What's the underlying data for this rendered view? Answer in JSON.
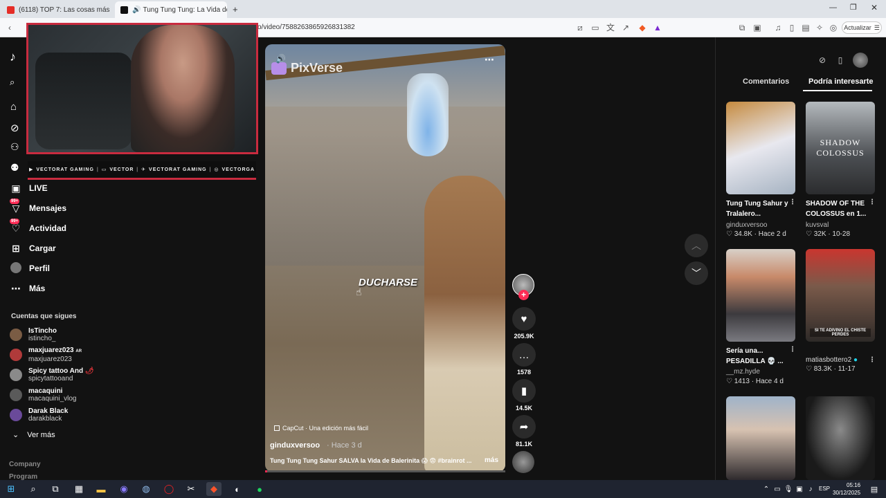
{
  "browser": {
    "tabs": [
      {
        "label": "(6118) TOP 7: Las cosas más PERTUR",
        "icon": "youtube-icon",
        "active": false
      },
      {
        "label": "Tung Tung Tung: La Vida de",
        "icon": "tiktok-icon",
        "active": true
      }
    ],
    "url": "o/video/7588263865926831382",
    "update_label": "Actualizar"
  },
  "sidebar": {
    "nav": [
      {
        "label": "LIVE",
        "icon": "live-icon"
      },
      {
        "label": "Mensajes",
        "icon": "messages-icon",
        "badge": "99+"
      },
      {
        "label": "Actividad",
        "icon": "activity-icon",
        "badge": "99+"
      },
      {
        "label": "Cargar",
        "icon": "upload-icon"
      },
      {
        "label": "Perfil",
        "icon": "profile-icon"
      },
      {
        "label": "Más",
        "icon": "more-icon"
      }
    ],
    "following_title": "Cuentas que sigues",
    "following": [
      {
        "name": "IsTincho",
        "handle": "istincho_",
        "color": "#7a5c44"
      },
      {
        "name": "maxjuarez023",
        "suffix": "AR",
        "handle": "maxjuarez023",
        "color": "#b03a3a"
      },
      {
        "name": "Spicy tattoo And",
        "handle": "spicytattooand",
        "color": "#8a8a8a"
      },
      {
        "name": "macaquini",
        "handle": "macaquini_vlog",
        "color": "#5a5a5a"
      },
      {
        "name": "Darak Black",
        "handle": "darakblack",
        "color": "#6a4a9a"
      }
    ],
    "see_more": "Ver más",
    "footer": [
      "Company",
      "Program"
    ]
  },
  "stream_overlay": {
    "socials": [
      {
        "label": "VECTORAT GAMING",
        "icon": "youtube-icon"
      },
      {
        "label": "VECTOR",
        "icon": "twitch-icon"
      },
      {
        "label": "VECTORAT GAMING",
        "icon": "twitter-icon"
      },
      {
        "label": "VECTORGA",
        "icon": "instagram-icon"
      }
    ]
  },
  "video": {
    "watermark": "PixVerse",
    "overlay_text": "DUCHARSE",
    "capcut": "CapCut · Una edición más fácil",
    "author": "ginduxversoo",
    "date": "· Hace 3 d",
    "description": "Tung Tung Tung Sahur SALVA la Vida de Balerinita 😱 😨 #brainrot ...",
    "more": "más",
    "progress": 0.01
  },
  "actions": {
    "likes": "205.9K",
    "comments": "1578",
    "saves": "14.5K",
    "shares": "81.1K"
  },
  "right_panel": {
    "tabs": [
      "Comentarios",
      "Podría interesarte"
    ],
    "cards": [
      {
        "title": "Tung Tung Sahur y Tralalero...",
        "author": "ginduxversoo",
        "stats": "♡ 34.8K · Hace 2 d"
      },
      {
        "title": "SHADOW OF THE COLOSSUS en 1...",
        "author": "kuvsval",
        "stats": "♡ 32K · 10-28",
        "thumb_text": "SHADOW COLOSSUS"
      },
      {
        "title": "Sería una... PESADILLA 💀 ...",
        "author": "__mz.hyde",
        "stats": "♡ 1413 · Hace 4 d"
      },
      {
        "title": "",
        "author": "matiasbottero2",
        "stats": "♡ 83.3K · 11-17",
        "thumb_text": "SI TE ADIVINO EL CHISTE PERDES"
      }
    ]
  },
  "taskbar": {
    "lang": "ESP",
    "time": "05:16",
    "date": "30/12/2025"
  }
}
